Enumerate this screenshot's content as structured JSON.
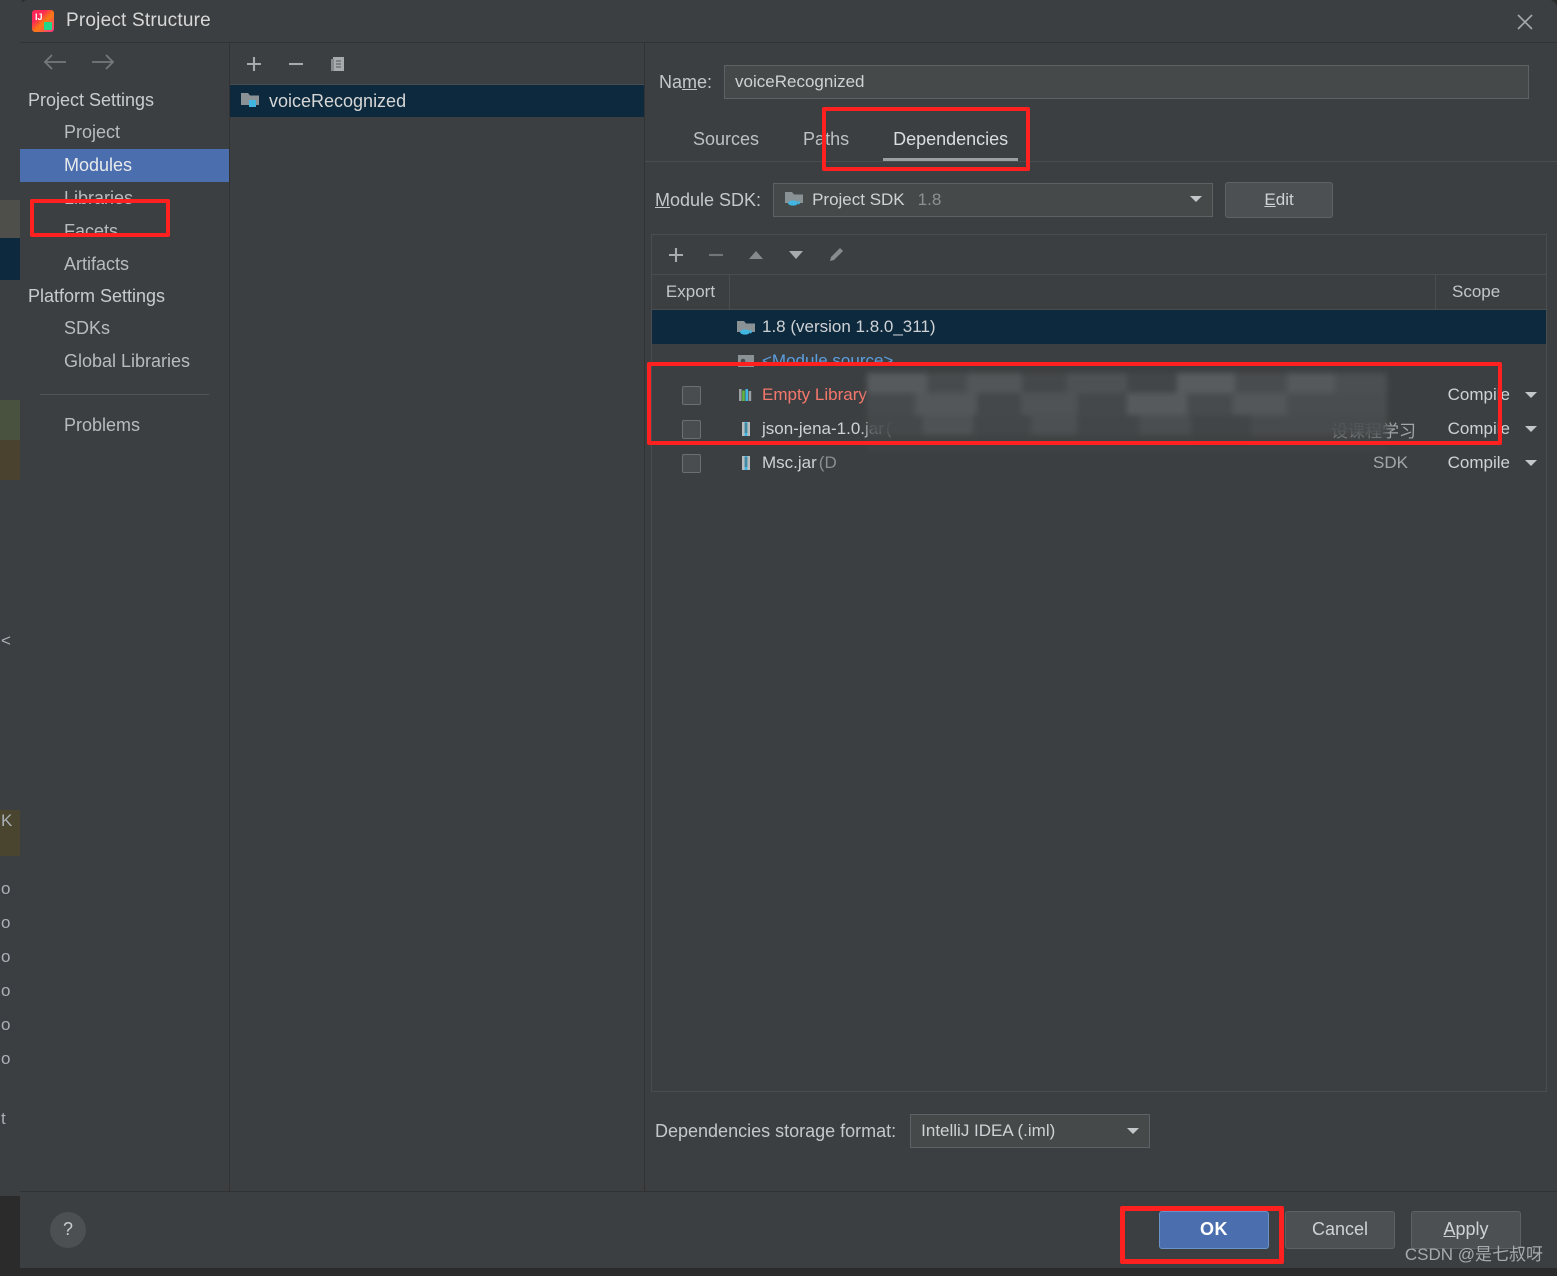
{
  "window": {
    "title": "Project Structure",
    "app_icon": "intellij-idea-logo",
    "close_icon": "close-icon"
  },
  "sidebar": {
    "back_icon": "arrow-left-icon",
    "forward_icon": "arrow-right-icon",
    "groups": [
      {
        "label": "Project Settings",
        "items": [
          {
            "label": "Project",
            "selected": false
          },
          {
            "label": "Modules",
            "selected": true
          },
          {
            "label": "Libraries",
            "selected": false
          },
          {
            "label": "Facets",
            "selected": false
          },
          {
            "label": "Artifacts",
            "selected": false
          }
        ]
      },
      {
        "label": "Platform Settings",
        "items": [
          {
            "label": "SDKs",
            "selected": false
          },
          {
            "label": "Global Libraries",
            "selected": false
          }
        ]
      }
    ],
    "problems_label": "Problems"
  },
  "modules_panel": {
    "toolbar": {
      "add_icon": "plus-icon",
      "remove_icon": "minus-icon",
      "copy_icon": "copy-icon"
    },
    "items": [
      {
        "label": "voiceRecognized",
        "icon": "module-folder-icon",
        "selected": true
      }
    ]
  },
  "content": {
    "name_label": "Name:",
    "name_value": "voiceRecognized",
    "tabs": [
      {
        "label": "Sources",
        "active": false
      },
      {
        "label": "Paths",
        "active": false
      },
      {
        "label": "Dependencies",
        "active": true
      }
    ],
    "sdk_label": "Module SDK:",
    "sdk_value": "Project SDK",
    "sdk_version": "1.8",
    "sdk_icon": "java-sdk-icon",
    "edit_button": "Edit",
    "dep_toolbar": {
      "add_icon": "plus-icon",
      "remove_icon": "minus-icon",
      "up_icon": "arrow-up-icon",
      "down_icon": "arrow-down-icon",
      "edit_icon": "pencil-icon"
    },
    "table": {
      "columns": [
        "Export",
        "",
        "Scope"
      ],
      "rows": [
        {
          "checkbox": null,
          "icon": "java-sdk-icon",
          "name": "1.8 (version 1.8.0_311)",
          "name_style": "normal",
          "scope": null,
          "selected": true
        },
        {
          "checkbox": null,
          "icon": "module-source-icon",
          "name": "<Module source>",
          "name_style": "link",
          "scope": null,
          "selected": false
        },
        {
          "checkbox": false,
          "icon": "library-icon",
          "name": "Empty Library",
          "name_style": "error",
          "scope": "Compile",
          "selected": false
        },
        {
          "checkbox": false,
          "icon": "jar-icon",
          "name": "json-jena-1.0.jar",
          "name_suffix": "(",
          "path_fragment": "设课程学习",
          "name_style": "normal",
          "scope": "Compile",
          "selected": false
        },
        {
          "checkbox": false,
          "icon": "jar-icon",
          "name": "Msc.jar",
          "name_suffix": "(D",
          "path_fragment": "SDK",
          "name_style": "normal",
          "scope": "Compile",
          "selected": false
        }
      ]
    },
    "storage_label": "Dependencies storage format:",
    "storage_value": "IntelliJ IDEA (.iml)"
  },
  "footer": {
    "help_icon": "question-mark-icon",
    "ok_label": "OK",
    "cancel_label": "Cancel",
    "apply_label": "Apply",
    "watermark": "CSDN @是七叔呀"
  },
  "backdrop_ghost_chars": [
    "<",
    "K",
    "o",
    "o",
    "o",
    "o",
    "o",
    "o",
    "t"
  ],
  "accent_colors": {
    "selection_blue": "#4b6eaf",
    "row_selection": "#0d293e",
    "highlight_red": "#ff2020",
    "link_blue": "#5c9ede",
    "error_red": "#f4776c"
  }
}
